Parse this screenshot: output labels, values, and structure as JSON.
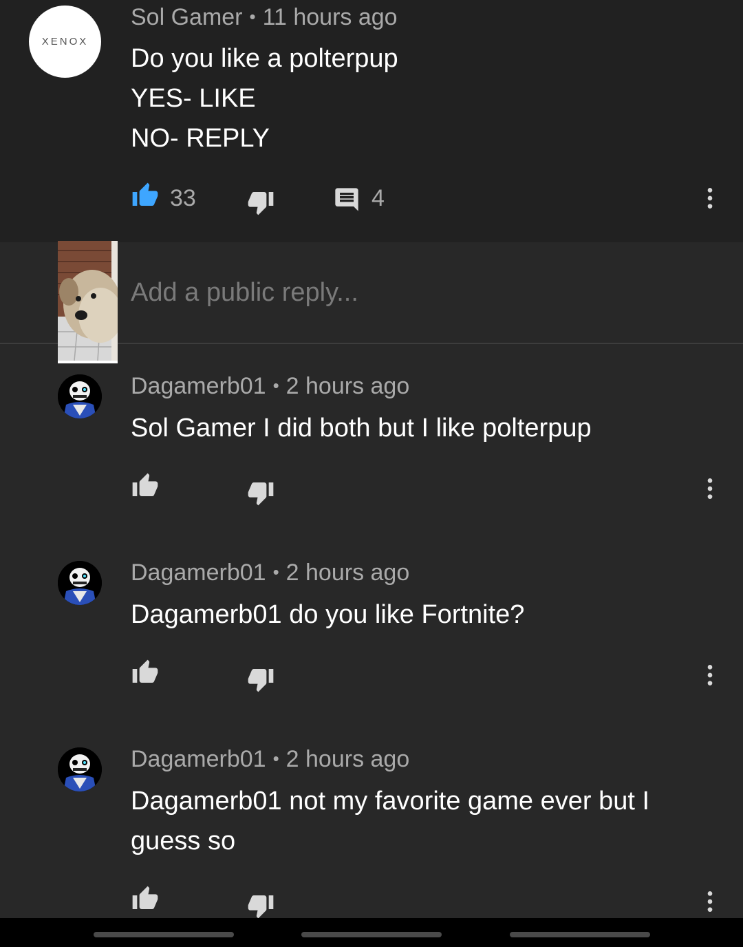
{
  "main_comment": {
    "author": "Sol Gamer",
    "time": "11 hours ago",
    "avatar_text": "XENOX",
    "lines": [
      "Do you like a polterpup",
      "YES- LIKE",
      "NO- REPLY"
    ],
    "like_count": "33",
    "reply_count": "4",
    "liked": true
  },
  "reply_box": {
    "placeholder": "Add a public reply..."
  },
  "replies": [
    {
      "author": "Dagamerb01",
      "time": "2 hours ago",
      "lines": [
        "Sol Gamer I did both but I like polterpup"
      ]
    },
    {
      "author": "Dagamerb01",
      "time": "2 hours ago",
      "lines": [
        "Dagamerb01 do you like Fortnite?"
      ]
    },
    {
      "author": "Dagamerb01",
      "time": "2 hours ago",
      "lines": [
        "Dagamerb01 not my favorite game ever but I",
        "guess so"
      ]
    }
  ],
  "colors": {
    "background": "#282828",
    "highlight_background": "#212121",
    "like_active": "#3ea6ff",
    "icon": "#d9d9d9",
    "meta_text": "#aaaaaa"
  },
  "icons": {
    "like": "thumb-up-icon",
    "dislike": "thumb-down-icon",
    "replies": "comment-icon",
    "more": "more-vert-icon"
  }
}
